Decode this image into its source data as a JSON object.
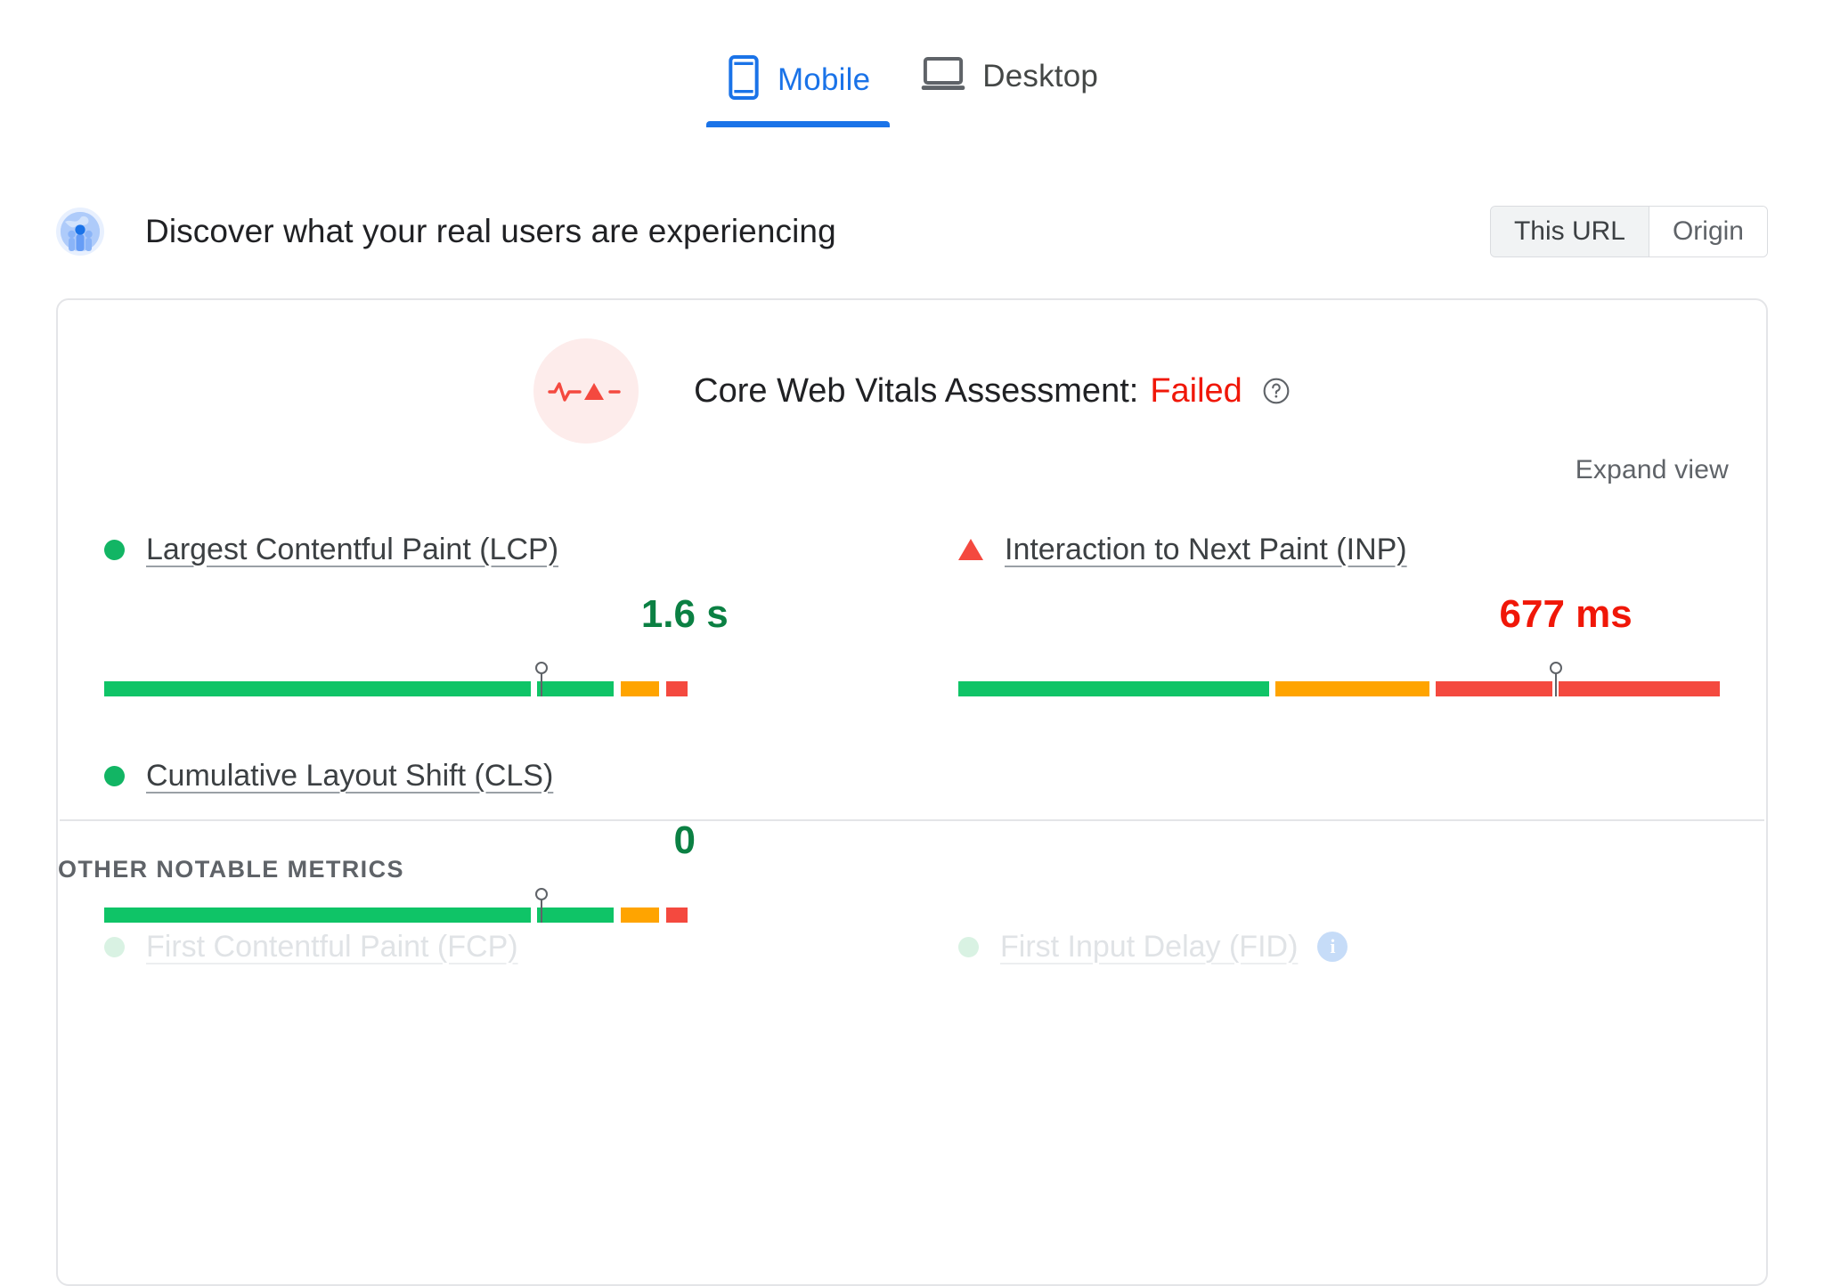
{
  "device_tabs": [
    {
      "label": "Mobile",
      "icon": "mobile-phone-icon",
      "active": true
    },
    {
      "label": "Desktop",
      "icon": "laptop-icon",
      "active": false
    }
  ],
  "discover": {
    "icon": "globe-users-icon",
    "title": "Discover what your real users are experiencing",
    "scope_toggle": {
      "options": [
        "This URL",
        "Origin"
      ],
      "selected": "This URL"
    }
  },
  "assessment": {
    "icon": "pulse-warning-icon",
    "label": "Core Web Vitals Assessment:",
    "verdict": "Failed",
    "verdict_color": "#f01708",
    "help_icon": "help-circle-icon",
    "expand_view_label": "Expand view"
  },
  "colors": {
    "good": "#0fc467",
    "needs_improvement": "#ffa400",
    "poor": "#f4493f",
    "good_text": "#0b8043",
    "poor_text": "#f01708",
    "accent": "#1a73e8"
  },
  "core_metrics": [
    {
      "id": "lcp",
      "name": "Largest Contentful Paint (LCP)",
      "status": "good",
      "status_marker": "dot",
      "value": "1.6 s",
      "value_color": "#0b8043",
      "marker_percent": 75,
      "segments": [
        {
          "rating": "good",
          "percent": 75
        },
        {
          "rating": "good",
          "percent": 13.5
        },
        {
          "rating": "needs_improvement",
          "percent": 6.7
        },
        {
          "rating": "poor",
          "percent": 3.8
        }
      ]
    },
    {
      "id": "inp",
      "name": "Interaction to Next Paint (INP)",
      "status": "poor",
      "status_marker": "triangle",
      "value": "677 ms",
      "value_color": "#f01708",
      "marker_percent": 78.5,
      "segments": [
        {
          "rating": "good",
          "percent": 41.5
        },
        {
          "rating": "needs_improvement",
          "percent": 20.5
        },
        {
          "rating": "poor",
          "percent": 15.5
        },
        {
          "rating": "poor",
          "percent": 21.5
        }
      ]
    },
    {
      "id": "cls",
      "name": "Cumulative Layout Shift (CLS)",
      "status": "good",
      "status_marker": "dot",
      "value": "0",
      "value_color": "#0b8043",
      "marker_percent": 75,
      "segments": [
        {
          "rating": "good",
          "percent": 75
        },
        {
          "rating": "good",
          "percent": 13.5
        },
        {
          "rating": "needs_improvement",
          "percent": 6.7
        },
        {
          "rating": "poor",
          "percent": 3.8
        }
      ]
    }
  ],
  "other_metrics_label": "OTHER NOTABLE METRICS",
  "other_metrics": [
    {
      "id": "fcp",
      "name": "First Contentful Paint (FCP)",
      "status_marker": "dot",
      "has_info_icon": false
    },
    {
      "id": "fid",
      "name": "First Input Delay (FID)",
      "status_marker": "dot",
      "has_info_icon": true,
      "info_icon": "info-circle-icon"
    }
  ]
}
